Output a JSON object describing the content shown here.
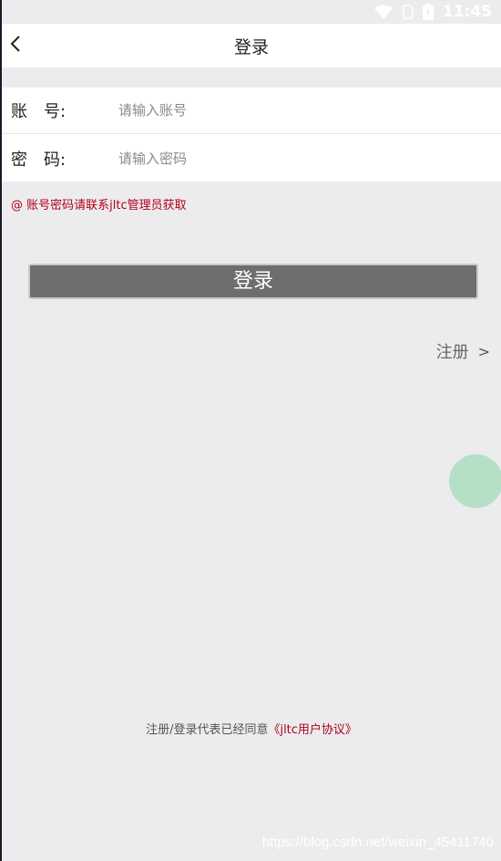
{
  "status_bar": {
    "time": "11:45"
  },
  "nav": {
    "title": "登录"
  },
  "form": {
    "account_label": "账　号:",
    "account_placeholder": "请输入账号",
    "password_label": "密　码:",
    "password_placeholder": "请输入密码"
  },
  "hint": "@ 账号密码请联系jltc管理员获取",
  "login_button": "登录",
  "register": {
    "label": "注册",
    "chevron": ">"
  },
  "agreement": {
    "prefix": "注册/登录代表已经同意",
    "link": "《jltc用户协议》"
  },
  "watermark": "https://blog.csdn.net/weixin_45411740",
  "colors": {
    "accent_red": "#b00018",
    "button_gray": "#6e6e6e",
    "float_green": "#b5e0c6"
  }
}
